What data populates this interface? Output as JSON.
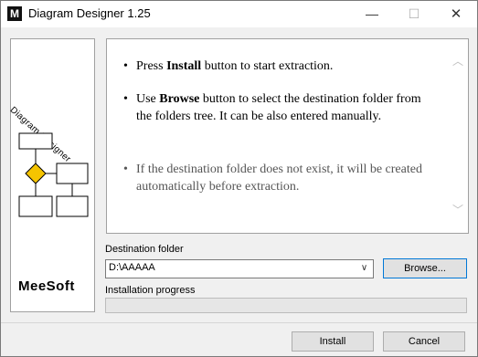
{
  "window": {
    "title": "Diagram Designer 1.25",
    "icon_letter": "M",
    "minimize_glyph": "—",
    "maximize_glyph": "☐",
    "close_glyph": "✕"
  },
  "sidebar": {
    "title": "Diagram Designer",
    "brand": "MeeSoft",
    "accent_color": "#f5c400"
  },
  "info": {
    "items": [
      {
        "prefix": "Press ",
        "bold": "Install",
        "suffix": " button to start extraction."
      },
      {
        "prefix": "Use ",
        "bold": "Browse",
        "suffix": " button to select the destination folder from the folders tree. It can be also entered manually."
      },
      {
        "prefix": "",
        "bold": "",
        "suffix": "If the destination folder does not exist, it will be created automatically before extraction."
      }
    ]
  },
  "destination": {
    "label": "Destination folder",
    "value": "D:\\AAAAA",
    "browse_label": "Browse..."
  },
  "progress": {
    "label": "Installation progress",
    "fraction": 0
  },
  "footer": {
    "install_label": "Install",
    "cancel_label": "Cancel"
  }
}
